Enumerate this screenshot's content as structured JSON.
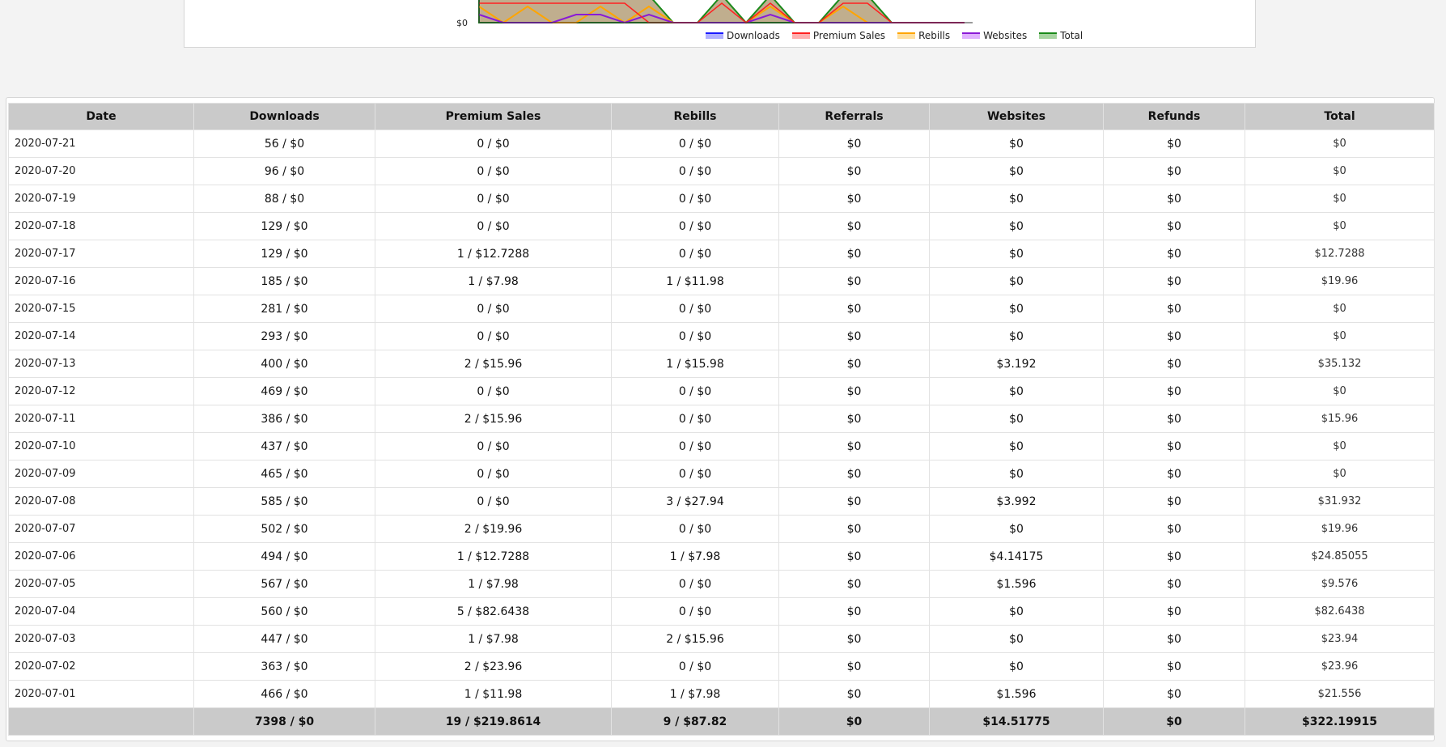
{
  "chart": {
    "y_tick": "$0",
    "legend": [
      {
        "label": "Downloads",
        "color": "#1a1aff",
        "fill": "#b0b0ff"
      },
      {
        "label": "Premium Sales",
        "color": "#ff2020",
        "fill": "#ffb0b0"
      },
      {
        "label": "Rebills",
        "color": "#ffa500",
        "fill": "#ffe0a0"
      },
      {
        "label": "Websites",
        "color": "#8a1ad6",
        "fill": "#e0b0ff"
      },
      {
        "label": "Total",
        "color": "#1a8a1a",
        "fill": "#a6d4a0"
      }
    ]
  },
  "table": {
    "headers": [
      "Date",
      "Downloads",
      "Premium Sales",
      "Rebills",
      "Referrals",
      "Websites",
      "Refunds",
      "Total"
    ],
    "rows": [
      [
        "2020-07-21",
        "56 / $0",
        "0 / $0",
        "0 / $0",
        "$0",
        "$0",
        "$0",
        "$0"
      ],
      [
        "2020-07-20",
        "96 / $0",
        "0 / $0",
        "0 / $0",
        "$0",
        "$0",
        "$0",
        "$0"
      ],
      [
        "2020-07-19",
        "88 / $0",
        "0 / $0",
        "0 / $0",
        "$0",
        "$0",
        "$0",
        "$0"
      ],
      [
        "2020-07-18",
        "129 / $0",
        "0 / $0",
        "0 / $0",
        "$0",
        "$0",
        "$0",
        "$0"
      ],
      [
        "2020-07-17",
        "129 / $0",
        "1 / $12.7288",
        "0 / $0",
        "$0",
        "$0",
        "$0",
        "$12.7288"
      ],
      [
        "2020-07-16",
        "185 / $0",
        "1 / $7.98",
        "1 / $11.98",
        "$0",
        "$0",
        "$0",
        "$19.96"
      ],
      [
        "2020-07-15",
        "281 / $0",
        "0 / $0",
        "0 / $0",
        "$0",
        "$0",
        "$0",
        "$0"
      ],
      [
        "2020-07-14",
        "293 / $0",
        "0 / $0",
        "0 / $0",
        "$0",
        "$0",
        "$0",
        "$0"
      ],
      [
        "2020-07-13",
        "400 / $0",
        "2 / $15.96",
        "1 / $15.98",
        "$0",
        "$3.192",
        "$0",
        "$35.132"
      ],
      [
        "2020-07-12",
        "469 / $0",
        "0 / $0",
        "0 / $0",
        "$0",
        "$0",
        "$0",
        "$0"
      ],
      [
        "2020-07-11",
        "386 / $0",
        "2 / $15.96",
        "0 / $0",
        "$0",
        "$0",
        "$0",
        "$15.96"
      ],
      [
        "2020-07-10",
        "437 / $0",
        "0 / $0",
        "0 / $0",
        "$0",
        "$0",
        "$0",
        "$0"
      ],
      [
        "2020-07-09",
        "465 / $0",
        "0 / $0",
        "0 / $0",
        "$0",
        "$0",
        "$0",
        "$0"
      ],
      [
        "2020-07-08",
        "585 / $0",
        "0 / $0",
        "3 / $27.94",
        "$0",
        "$3.992",
        "$0",
        "$31.932"
      ],
      [
        "2020-07-07",
        "502 / $0",
        "2 / $19.96",
        "0 / $0",
        "$0",
        "$0",
        "$0",
        "$19.96"
      ],
      [
        "2020-07-06",
        "494 / $0",
        "1 / $12.7288",
        "1 / $7.98",
        "$0",
        "$4.14175",
        "$0",
        "$24.85055"
      ],
      [
        "2020-07-05",
        "567 / $0",
        "1 / $7.98",
        "0 / $0",
        "$0",
        "$1.596",
        "$0",
        "$9.576"
      ],
      [
        "2020-07-04",
        "560 / $0",
        "5 / $82.6438",
        "0 / $0",
        "$0",
        "$0",
        "$0",
        "$82.6438"
      ],
      [
        "2020-07-03",
        "447 / $0",
        "1 / $7.98",
        "2 / $15.96",
        "$0",
        "$0",
        "$0",
        "$23.94"
      ],
      [
        "2020-07-02",
        "363 / $0",
        "2 / $23.96",
        "0 / $0",
        "$0",
        "$0",
        "$0",
        "$23.96"
      ],
      [
        "2020-07-01",
        "466 / $0",
        "1 / $11.98",
        "1 / $7.98",
        "$0",
        "$1.596",
        "$0",
        "$21.556"
      ]
    ],
    "footer": [
      "",
      "7398 / $0",
      "19 / $219.8614",
      "9 / $87.82",
      "$0",
      "$14.51775",
      "$0",
      "$322.19915"
    ]
  }
}
